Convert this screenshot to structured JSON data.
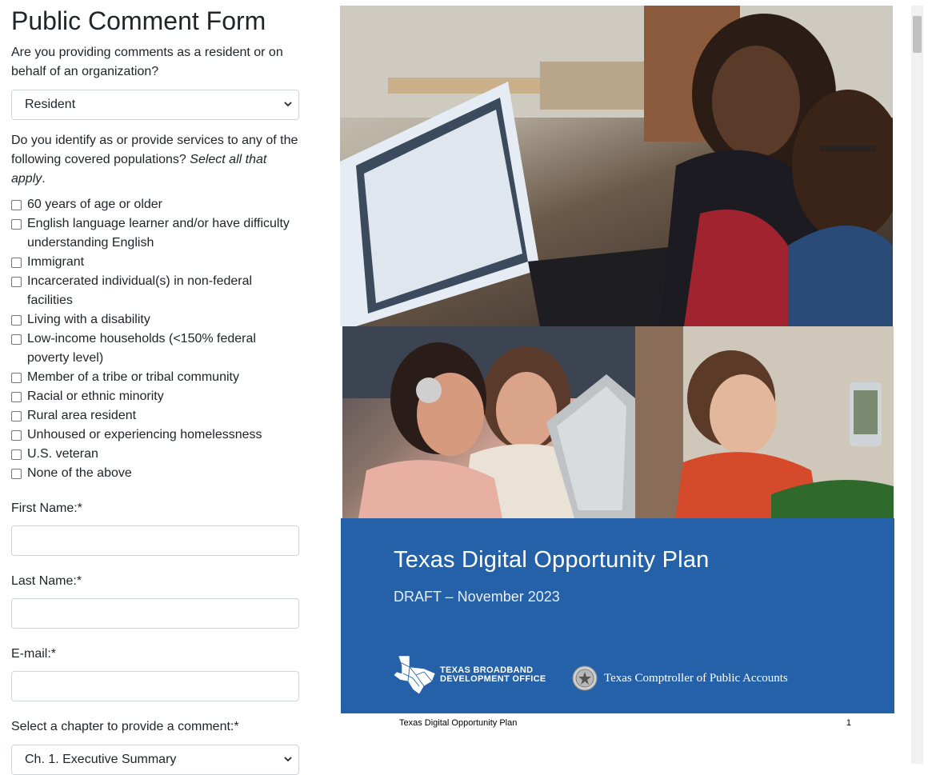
{
  "form": {
    "title": "Public Comment Form",
    "q_role": "Are you providing comments as a resident or on behalf of an organization?",
    "role_selected": "Resident",
    "q_populations": "Do you identify as or provide services to any of the following covered populations? ",
    "q_populations_emph": "Select all that apply",
    "q_populations_end": ".",
    "populations": [
      "60 years of age or older",
      "English language learner and/or have difficulty understanding English",
      "Immigrant",
      "Incarcerated individual(s) in non-federal facilities",
      "Living with a disability",
      "Low-income households (<150% federal poverty level)",
      "Member of a tribe or tribal community",
      "Racial or ethnic minority",
      "Rural area resident",
      "Unhoused or experiencing homelessness",
      "U.S. veteran",
      "None of the above"
    ],
    "first_name_label": "First Name:*",
    "first_name_value": "",
    "last_name_label": "Last Name:*",
    "last_name_value": "",
    "email_label": "E-mail:*",
    "email_value": "",
    "chapter_label": "Select a chapter to provide a comment:*",
    "chapter_selected": "Ch. 1. Executive Summary"
  },
  "document": {
    "cover_title": "Texas Digital Opportunity Plan",
    "cover_subtitle": "DRAFT – November 2023",
    "tbdo_line1": "TEXAS BROADBAND",
    "tbdo_line2": "DEVELOPMENT OFFICE",
    "cpa_name": "Texas Comptroller of Public Accounts",
    "footer_title": "Texas Digital Opportunity Plan",
    "footer_page": "1",
    "cover_color": "#2461a8"
  },
  "icons": {
    "select_arrow": "chevron-down-icon",
    "tbdo_logo": "texas-map-logo-icon",
    "cpa_seal": "state-seal-icon"
  }
}
